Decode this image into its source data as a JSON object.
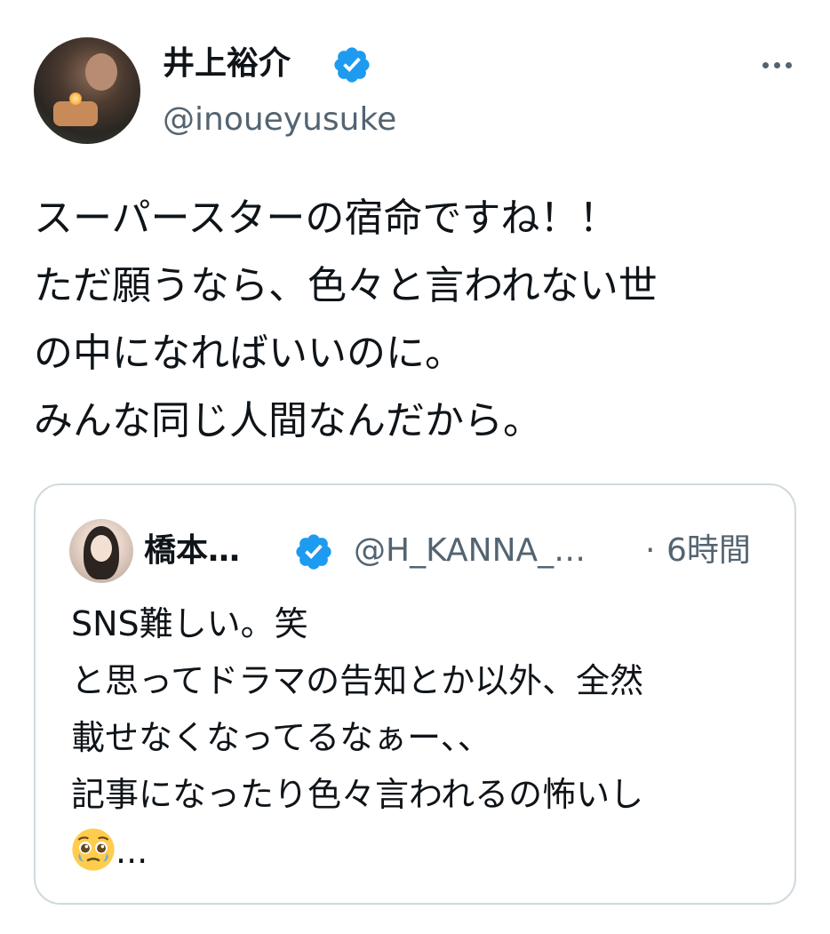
{
  "tweet": {
    "author": {
      "name": "井上裕介",
      "handle": "@inoueyusuke",
      "verified": true
    },
    "menu_icon": "more-horizontal-icon",
    "text_lines": [
      "スーパースターの宿命ですね！！",
      "ただ願うなら、色々と言われない世",
      "の中になればいいのに。",
      "みんな同じ人間なんだから。"
    ]
  },
  "quote": {
    "author": {
      "name": "橋本…",
      "handle": "@H_KANNA_…",
      "verified": true
    },
    "separator": "·",
    "time": "6時間",
    "text_lines": [
      "SNS難しい。笑",
      "と思ってドラマの告知とか以外、全然",
      "載せなくなってるなぁー、、",
      "記事になったり色々言われるの怖いし"
    ],
    "last_line_emoji": "pleading-face-emoji",
    "last_line_text": "..."
  },
  "colors": {
    "text_primary": "#0f1419",
    "text_secondary": "#536471",
    "verified_blue": "#1d9bf0",
    "border": "#cfd9de"
  }
}
